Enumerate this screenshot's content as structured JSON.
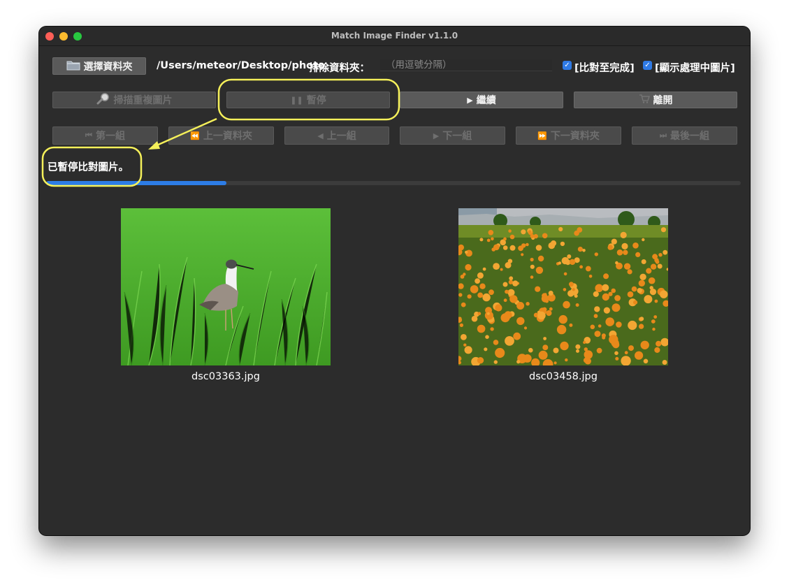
{
  "window": {
    "title": "Match Image Finder v1.1.0"
  },
  "toolbar": {
    "select_folder_label": "選擇資料夾",
    "path": "/Users/meteor/Desktop/photo",
    "exclude_label": "排除資料夾：",
    "exclude_placeholder": "（用逗號分隔）",
    "exclude_value": "",
    "compare_to_finish_label": "[比對至完成]",
    "compare_to_finish_checked": true,
    "show_processing_label": "[顯示處理中圖片]",
    "show_processing_checked": true
  },
  "actions": {
    "scan_label": "掃描重複圖片",
    "pause_label": "暫停",
    "resume_label": "繼續",
    "exit_label": "離開"
  },
  "nav": {
    "first_group": "第一組",
    "prev_folder": "上一資料夾",
    "prev_group": "上一組",
    "next_group": "下一組",
    "next_folder": "下一資料夾",
    "last_group": "最後一組"
  },
  "status": {
    "text": "已暫停比對圖片。",
    "progress": 0.26
  },
  "images": [
    {
      "filename": "dsc03363.jpg"
    },
    {
      "filename": "dsc03458.jpg"
    }
  ],
  "colors": {
    "accent": "#2d7de6",
    "annotation": "#f5f05a",
    "window_bg": "#2c2c2c"
  }
}
